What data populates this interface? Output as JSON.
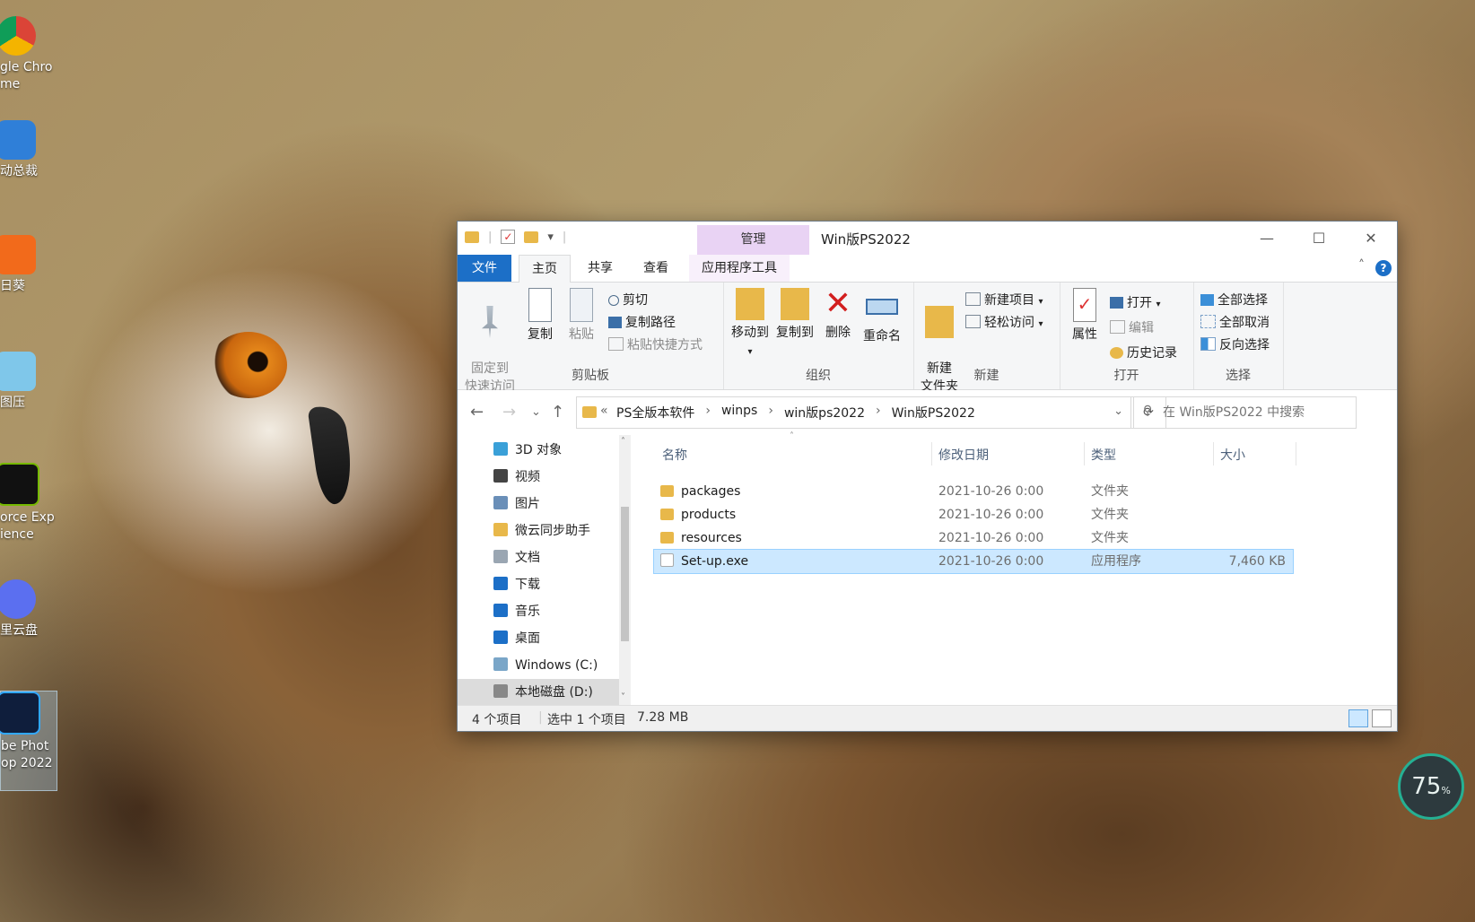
{
  "desktop": {
    "icons": [
      {
        "label": "gle Chro\nme",
        "icon": "chrome-icon"
      },
      {
        "label": "动总裁",
        "icon": "driver-icon"
      },
      {
        "label": "日葵",
        "icon": "sunflower-icon"
      },
      {
        "label": "图压",
        "icon": "image-compress-icon"
      },
      {
        "label": "orce Exp\nience",
        "icon": "nvidia-icon"
      },
      {
        "label": "里云盘",
        "icon": "aliyun-drive-icon"
      },
      {
        "label": "be Phot\nop 2022",
        "icon": "photoshop-icon"
      }
    ]
  },
  "window": {
    "title": "Win版PS2022",
    "manage_tab": "管理",
    "tabs": {
      "file": "文件",
      "home": "主页",
      "share": "共享",
      "view": "查看",
      "app_tools": "应用程序工具"
    },
    "ribbon": {
      "clipboard": {
        "pin": "固定到\n快速访问",
        "copy": "复制",
        "paste": "粘贴",
        "cut": "剪切",
        "copy_path": "复制路径",
        "paste_shortcut": "粘贴快捷方式",
        "label": "剪贴板"
      },
      "organize": {
        "move_to": "移动到",
        "copy_to": "复制到",
        "delete": "删除",
        "rename": "重命名",
        "label": "组织"
      },
      "new": {
        "new_folder": "新建\n文件夹",
        "new_item": "新建项目",
        "easy_access": "轻松访问",
        "label": "新建"
      },
      "open": {
        "properties": "属性",
        "open": "打开",
        "edit": "编辑",
        "history": "历史记录",
        "label": "打开"
      },
      "select": {
        "select_all": "全部选择",
        "select_none": "全部取消",
        "invert": "反向选择",
        "label": "选择"
      }
    },
    "address": {
      "prefix": "«",
      "crumbs": [
        "PS全版本软件",
        "winps",
        "win版ps2022",
        "Win版PS2022"
      ],
      "search_placeholder": "在 Win版PS2022 中搜索"
    },
    "nav_pane": [
      {
        "label": "3D 对象",
        "icon": "3d-objects-icon",
        "color": "#3aa0d8"
      },
      {
        "label": "视频",
        "icon": "video-icon",
        "color": "#444"
      },
      {
        "label": "图片",
        "icon": "pictures-icon",
        "color": "#6a8fb8"
      },
      {
        "label": "微云同步助手",
        "icon": "weiyun-icon",
        "color": "#e8b84a"
      },
      {
        "label": "文档",
        "icon": "documents-icon",
        "color": "#9aa6b2"
      },
      {
        "label": "下载",
        "icon": "download-icon",
        "color": "#1c6fc7"
      },
      {
        "label": "音乐",
        "icon": "music-icon",
        "color": "#1c6fc7"
      },
      {
        "label": "桌面",
        "icon": "desktop-icon",
        "color": "#1c6fc7"
      },
      {
        "label": "Windows (C:)",
        "icon": "drive-c-icon",
        "color": "#7aa6c8"
      },
      {
        "label": "本地磁盘 (D:)",
        "icon": "drive-d-icon",
        "color": "#888"
      }
    ],
    "columns": {
      "name": "名称",
      "modified": "修改日期",
      "type": "类型",
      "size": "大小"
    },
    "files": [
      {
        "name": "packages",
        "modified": "2021-10-26 0:00",
        "type": "文件夹",
        "size": ""
      },
      {
        "name": "products",
        "modified": "2021-10-26 0:00",
        "type": "文件夹",
        "size": ""
      },
      {
        "name": "resources",
        "modified": "2021-10-26 0:00",
        "type": "文件夹",
        "size": ""
      },
      {
        "name": "Set-up.exe",
        "modified": "2021-10-26 0:00",
        "type": "应用程序",
        "size": "7,460 KB"
      }
    ],
    "status": {
      "count": "4 个项目",
      "selected": "选中 1 个项目",
      "size": "7.28 MB"
    }
  },
  "overlay": {
    "gauge_value": "75",
    "gauge_unit": "%"
  },
  "colors": {
    "accent": "#1c6fc7",
    "manage_tab": "#e9d3f4",
    "selection": "#cce8ff"
  }
}
